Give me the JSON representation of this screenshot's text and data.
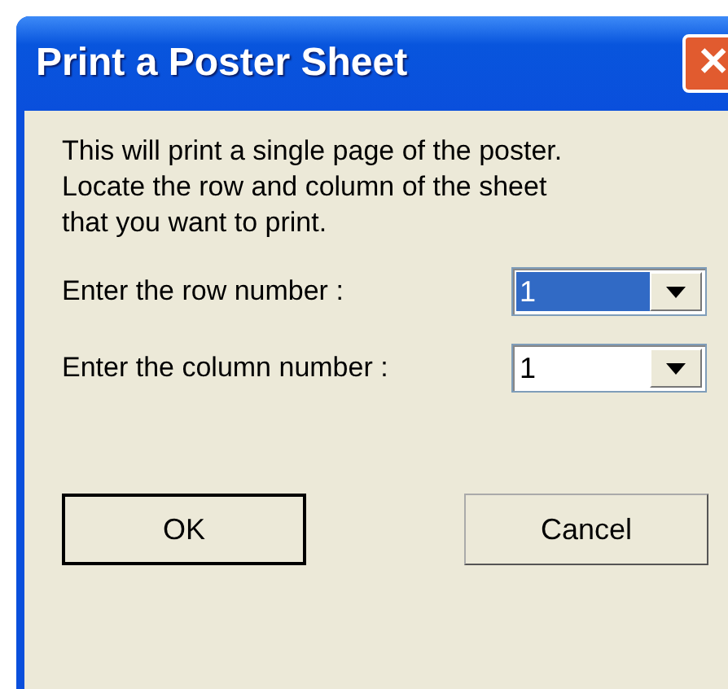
{
  "window": {
    "title": "Print a Poster Sheet",
    "close": "✕"
  },
  "message": [
    "This will print a single page of the poster.",
    "Locate the row and column of the sheet",
    "that you want to print."
  ],
  "fields": [
    {
      "label": "Enter the row number :",
      "value": "1",
      "selected": true
    },
    {
      "label": "Enter the column number :",
      "value": "1",
      "selected": false
    }
  ],
  "buttons": [
    {
      "label": "OK",
      "default": true
    },
    {
      "label": "Cancel",
      "default": false
    }
  ]
}
